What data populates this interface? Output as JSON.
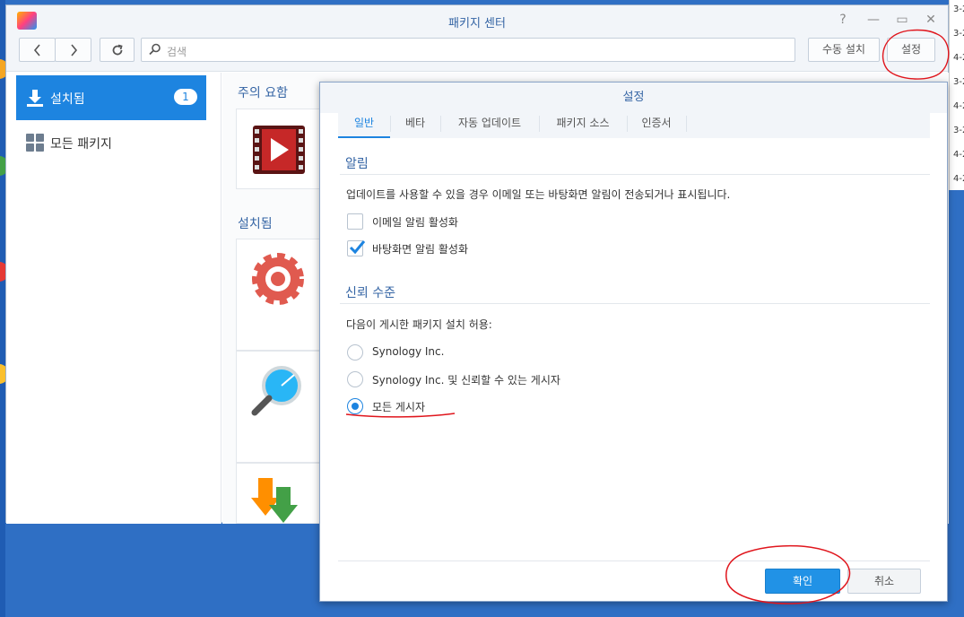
{
  "window": {
    "title": "패키지 센터",
    "controls": {
      "help": "?",
      "minimize": "—",
      "maximize": "▭",
      "close": "✕"
    }
  },
  "toolbar": {
    "search_placeholder": "검색",
    "manual_install_label": "수동 설치",
    "settings_label": "설정"
  },
  "sidebar": {
    "items": [
      {
        "label": "설치됨",
        "badge": "1",
        "icon": "download-icon",
        "active": true
      },
      {
        "label": "모든 패키지",
        "icon": "grid-icon",
        "active": false
      }
    ]
  },
  "content": {
    "featured_title": "주의 요함",
    "installed_title": "설치됨"
  },
  "dialog": {
    "title": "설정",
    "tabs": [
      "일반",
      "베타",
      "자동 업데이트",
      "패키지 소스",
      "인증서"
    ],
    "active_tab": "일반",
    "notification": {
      "heading": "알림",
      "description": "업데이트를 사용할 수 있을 경우 이메일 또는 바탕화면 알림이 전송되거나 표시됩니다.",
      "options": [
        {
          "label": "이메일 알림 활성화",
          "checked": false
        },
        {
          "label": "바탕화면 알림 활성화",
          "checked": true
        }
      ]
    },
    "trust": {
      "heading": "신뢰 수준",
      "description": "다음이 게시한 패키지 설치 허용:",
      "options": [
        {
          "label": "Synology Inc.",
          "selected": false
        },
        {
          "label": "Synology Inc. 및 신뢰할 수 있는 게시자",
          "selected": false
        },
        {
          "label": "모든 게시자",
          "selected": true
        }
      ]
    },
    "ok_label": "확인",
    "cancel_label": "취소"
  },
  "desktop": {
    "right_edge_text": [
      "3-2",
      "3-2",
      "4-2",
      "3-2",
      "4-2",
      "3-2",
      "4-2",
      "4-2"
    ]
  },
  "colors": {
    "accent": "#1d84e0",
    "annotation": "#e0161d",
    "title_text": "#3464a4"
  }
}
